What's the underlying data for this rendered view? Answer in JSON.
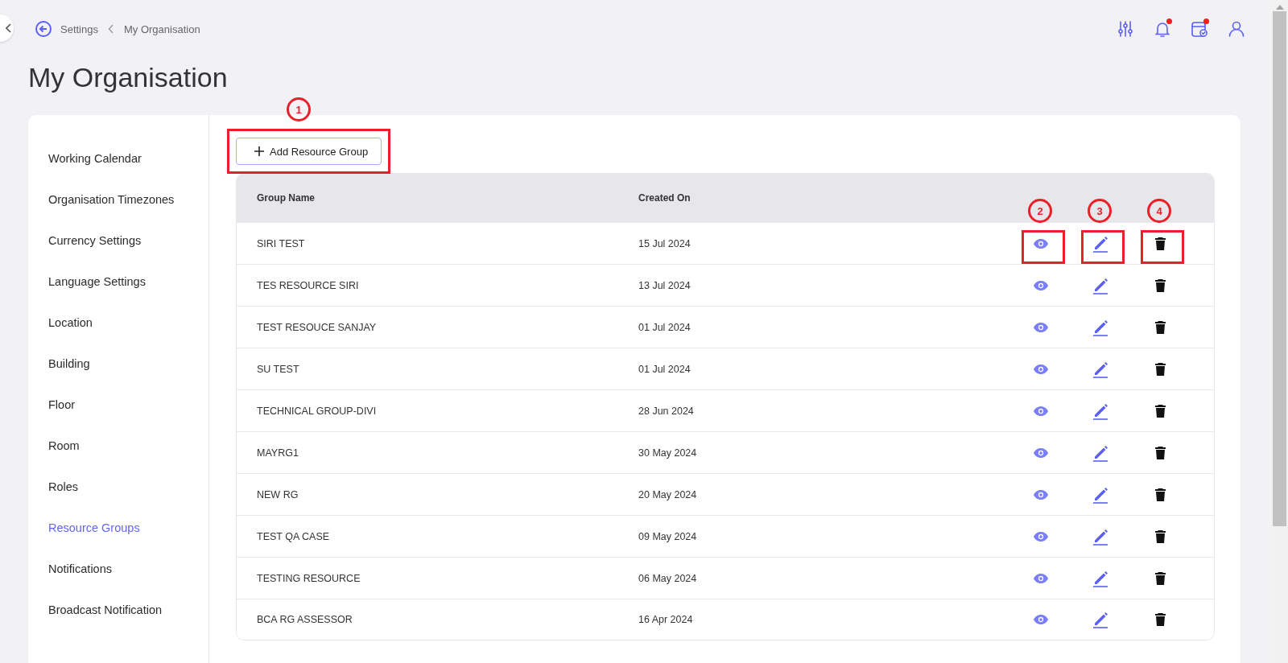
{
  "breadcrumb": [
    "Settings",
    "My Organisation"
  ],
  "title": "My Organisation",
  "top_icons": [
    {
      "kind": "sliders",
      "badge": false
    },
    {
      "kind": "bell",
      "badge": true
    },
    {
      "kind": "calendar",
      "badge": true
    },
    {
      "kind": "user",
      "badge": false
    }
  ],
  "sidebar": {
    "items": [
      {
        "label": "Working Calendar",
        "selected": false
      },
      {
        "label": "Organisation Timezones",
        "selected": false
      },
      {
        "label": "Currency Settings",
        "selected": false
      },
      {
        "label": "Language Settings",
        "selected": false
      },
      {
        "label": "Location",
        "selected": false
      },
      {
        "label": "Building",
        "selected": false
      },
      {
        "label": "Floor",
        "selected": false
      },
      {
        "label": "Room",
        "selected": false
      },
      {
        "label": "Roles",
        "selected": false
      },
      {
        "label": "Resource Groups",
        "selected": true
      },
      {
        "label": "Notifications",
        "selected": false
      },
      {
        "label": "Broadcast Notification",
        "selected": false
      }
    ]
  },
  "add_button": {
    "label": "Add Resource Group",
    "callout": "1"
  },
  "table": {
    "columns": [
      "Group Name",
      "Created On"
    ],
    "actions": [
      {
        "kind": "view",
        "callout": "2"
      },
      {
        "kind": "edit",
        "callout": "3"
      },
      {
        "kind": "delete",
        "callout": "4"
      }
    ],
    "rows": [
      {
        "name": "SIRI TEST",
        "created": "15 Jul 2024",
        "highlighted": true
      },
      {
        "name": "TES RESOURCE SIRI",
        "created": "13 Jul 2024",
        "highlighted": false
      },
      {
        "name": "TEST RESOUCE SANJAY",
        "created": "01 Jul 2024",
        "highlighted": false
      },
      {
        "name": "SU TEST",
        "created": "01 Jul 2024",
        "highlighted": false
      },
      {
        "name": "TECHNICAL GROUP-DIVI",
        "created": "28 Jun 2024",
        "highlighted": false
      },
      {
        "name": "MAYRG1",
        "created": "30 May 2024",
        "highlighted": false
      },
      {
        "name": "NEW RG",
        "created": "20 May 2024",
        "highlighted": false
      },
      {
        "name": "TEST QA CASE",
        "created": "09 May 2024",
        "highlighted": false
      },
      {
        "name": "TESTING RESOURCE",
        "created": "06 May 2024",
        "highlighted": false
      },
      {
        "name": "BCA RG ASSESSOR",
        "created": "16 Apr 2024",
        "highlighted": false
      }
    ]
  }
}
